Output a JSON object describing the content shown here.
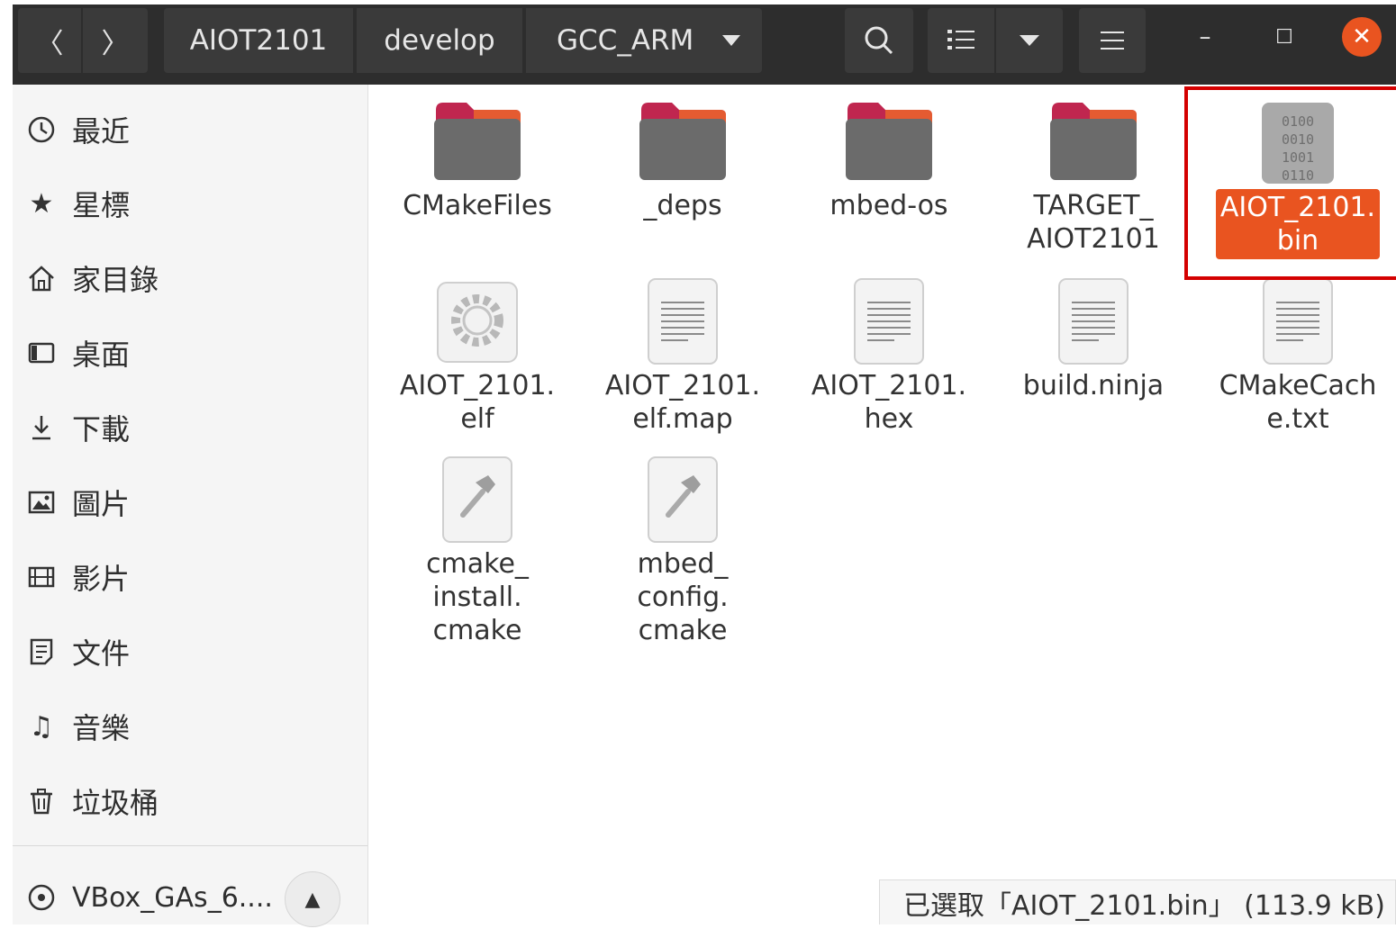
{
  "toolbar": {
    "back_icon": "chevron-left-icon",
    "forward_icon": "chevron-right-icon",
    "breadcrumbs": [
      "AIOT2101",
      "develop",
      "GCC_ARM"
    ],
    "search_icon": "search-icon",
    "view_icon": "list-view-icon",
    "sort_icon": "chevron-down-icon",
    "menu_icon": "hamburger-menu-icon"
  },
  "window_controls": {
    "minimize": "–",
    "maximize": "☐",
    "close": "✕"
  },
  "sidebar": {
    "items": [
      {
        "label": "最近",
        "icon": "clock-icon"
      },
      {
        "label": "星標",
        "icon": "star-icon"
      },
      {
        "label": "家目錄",
        "icon": "home-icon"
      },
      {
        "label": "桌面",
        "icon": "desktop-icon"
      },
      {
        "label": "下載",
        "icon": "download-icon"
      },
      {
        "label": "圖片",
        "icon": "image-icon"
      },
      {
        "label": "影片",
        "icon": "film-icon"
      },
      {
        "label": "文件",
        "icon": "document-icon"
      },
      {
        "label": "音樂",
        "icon": "music-icon"
      },
      {
        "label": "垃圾桶",
        "icon": "trash-icon"
      }
    ],
    "device": {
      "label": "VBox_GAs_6....",
      "icon": "disc-icon",
      "eject_icon": "eject-icon"
    }
  },
  "files": [
    {
      "name": "CMakeFiles",
      "type": "folder"
    },
    {
      "name": "_deps",
      "type": "folder"
    },
    {
      "name": "mbed-os",
      "type": "folder"
    },
    {
      "name": "TARGET_\nAIOT2101",
      "type": "folder"
    },
    {
      "name": "AIOT_2101.\nbin",
      "type": "binary",
      "selected": true
    },
    {
      "name": "AIOT_2101.\nelf",
      "type": "executable"
    },
    {
      "name": "AIOT_2101.\nelf.map",
      "type": "text"
    },
    {
      "name": "AIOT_2101.\nhex",
      "type": "text"
    },
    {
      "name": "build.ninja",
      "type": "text"
    },
    {
      "name": "CMakeCach\ne.txt",
      "type": "text"
    },
    {
      "name": "cmake_\ninstall.\ncmake",
      "type": "script"
    },
    {
      "name": "mbed_\nconfig.\ncmake",
      "type": "script"
    }
  ],
  "status": {
    "text": "已選取「AIOT_2101.bin」 (113.9 kB)"
  },
  "colors": {
    "accent": "#e95420",
    "titlebar": "#2d2d2d",
    "highlight_box": "#d40000"
  }
}
